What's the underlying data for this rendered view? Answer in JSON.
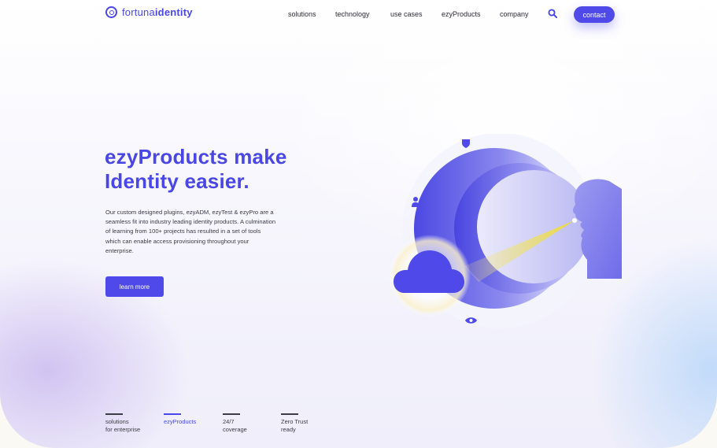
{
  "header": {
    "logo_prefix": "fortuna",
    "logo_suffix": "identity",
    "nav": [
      "solutions",
      "technology",
      "use cases",
      "ezyProducts",
      "company"
    ],
    "contact_label": "contact"
  },
  "hero": {
    "title_line1": "ezyProducts make",
    "title_line2": "Identity easier.",
    "body": "Our custom designed plugins, ezyADM, ezyTest & ezyPro are a seamless fit into industry leading identity products. A culmination of learning from 100+ projects has resulted in a set of tools which can enable access provisioning throughout your enterprise.",
    "cta_label": "learn more"
  },
  "features": [
    {
      "line1": "solutions",
      "line2": "for enterprise",
      "active": false
    },
    {
      "line1": "ezyProducts",
      "line2": "",
      "active": true
    },
    {
      "line1": "24/7",
      "line2": "coverage",
      "active": false
    },
    {
      "line1": "Zero Trust",
      "line2": "ready",
      "active": false
    }
  ],
  "colors": {
    "accent": "#4e49e8",
    "text": "#3c3c46",
    "beam": "#f2e04a"
  },
  "icons": [
    "logo-icon",
    "search-icon",
    "person-icon",
    "shield-icon",
    "eye-icon",
    "cloud-icon",
    "face-profile-icon"
  ]
}
